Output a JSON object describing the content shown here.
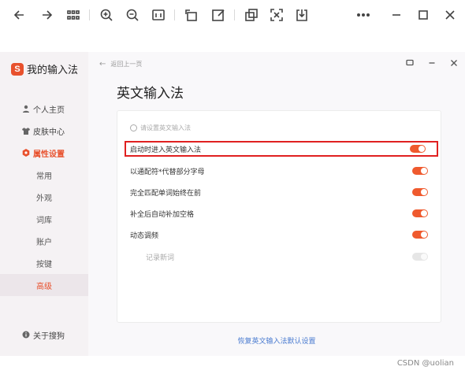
{
  "toolbar": {
    "icons": [
      "back-arrow",
      "forward-arrow",
      "grid-view",
      "zoom-in",
      "zoom-out",
      "one-to-one",
      "rotate",
      "edit",
      "copy",
      "ocr",
      "download",
      "more",
      "minimize",
      "maximize",
      "close"
    ]
  },
  "app": {
    "brand": {
      "logo_letter": "S",
      "name": "我的输入法"
    },
    "nav": [
      {
        "label": "个人主页",
        "icon": "user-icon"
      },
      {
        "label": "皮肤中心",
        "icon": "shirt-icon"
      },
      {
        "label": "属性设置",
        "icon": "settings-icon",
        "active": true
      }
    ],
    "sub_nav": [
      {
        "label": "常用"
      },
      {
        "label": "外观"
      },
      {
        "label": "词库"
      },
      {
        "label": "账户"
      },
      {
        "label": "按键"
      },
      {
        "label": "高级",
        "selected": true
      }
    ],
    "about": {
      "label": "关于搜狗"
    },
    "back_label": "返回上一页",
    "page_title": "英文输入法",
    "hint": "请设置英文输入法",
    "settings": [
      {
        "label": "启动时进入英文输入法",
        "enabled": true
      },
      {
        "label": "以通配符*代替部分字母",
        "enabled": true
      },
      {
        "label": "完全匹配单词始终在前",
        "enabled": true
      },
      {
        "label": "补全后自动补加空格",
        "enabled": true
      },
      {
        "label": "动态调频",
        "enabled": true
      },
      {
        "label": "记录新词",
        "enabled": false
      }
    ],
    "restore_link": "恢复英文输入法默认设置"
  },
  "watermark": "CSDN @uolian",
  "colors": {
    "accent": "#ef5a2e",
    "highlight_border": "#e02020",
    "link": "#4a7bd0"
  }
}
